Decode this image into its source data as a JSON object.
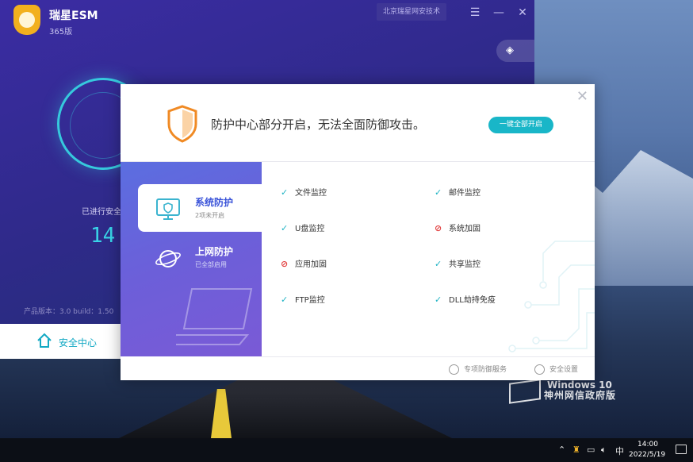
{
  "app": {
    "name": "瑞星ESM",
    "edition": "365版",
    "company_button": "北京瑞星网安技术",
    "days_label": "已进行安全",
    "days_value": "14",
    "version_info": "产品版本：3.0  build：1.50",
    "bottom_tab": "安全中心"
  },
  "dialog": {
    "message": "防护中心部分开启，无法全面防御攻击。",
    "enable_all_button": "一键全部开启",
    "tabs": [
      {
        "title": "系统防护",
        "subtitle": "2项未开启"
      },
      {
        "title": "上网防护",
        "subtitle": "已全部启用"
      }
    ],
    "items": [
      {
        "label": "文件监控",
        "status": "on"
      },
      {
        "label": "邮件监控",
        "status": "on"
      },
      {
        "label": "U盘监控",
        "status": "on"
      },
      {
        "label": "系统加固",
        "status": "off"
      },
      {
        "label": "应用加固",
        "status": "off"
      },
      {
        "label": "共享监控",
        "status": "on"
      },
      {
        "label": "FTP监控",
        "status": "on"
      },
      {
        "label": "DLL劫持免疫",
        "status": "on"
      }
    ],
    "footer": {
      "service": "专项防御服务",
      "settings": "安全设置"
    }
  },
  "desktop": {
    "watermark_line1": "Windows 10",
    "watermark_line2": "神州网信政府版"
  },
  "taskbar": {
    "ime": "中",
    "time": "14:00",
    "date": "2022/5/19"
  },
  "colors": {
    "accent": "#19b6c8",
    "app_bg": "#2f2a8a",
    "ok": "#1fb3c4",
    "off": "#e24040"
  }
}
